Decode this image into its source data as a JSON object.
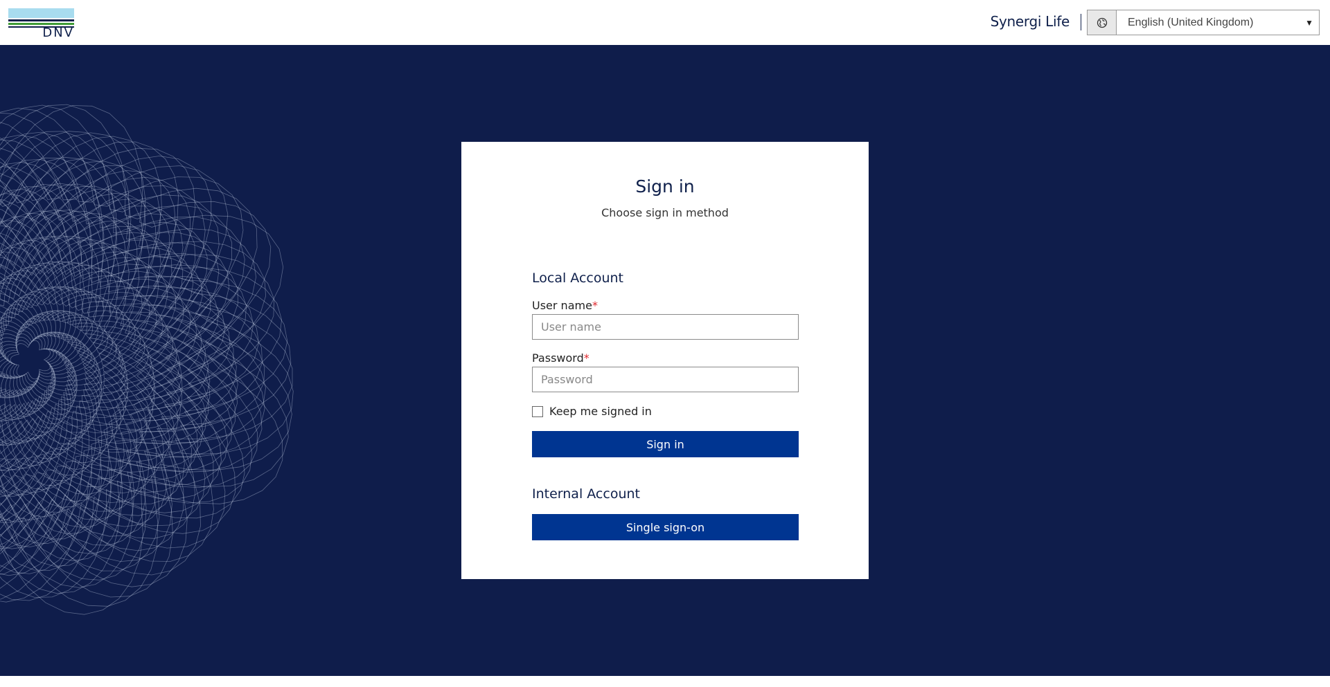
{
  "header": {
    "logo_text": "DNV",
    "app_name": "Synergi Life",
    "language": {
      "icon": "globe-icon",
      "selected": "English (United Kingdom)"
    }
  },
  "signin": {
    "title": "Sign in",
    "subtitle": "Choose sign in method",
    "local": {
      "heading": "Local Account",
      "username_label": "User name",
      "username_placeholder": "User name",
      "password_label": "Password",
      "password_placeholder": "Password",
      "required_mark": "*",
      "keep_signed_in": "Keep me signed in",
      "signin_button": "Sign in"
    },
    "internal": {
      "heading": "Internal Account",
      "sso_button": "Single sign-on"
    }
  },
  "colors": {
    "background": "#0f1d4b",
    "brand_navy": "#0f204b",
    "button": "#003591",
    "required": "#e0282d",
    "logo_light_blue": "#a8dcef",
    "logo_green": "#3f9c35"
  }
}
